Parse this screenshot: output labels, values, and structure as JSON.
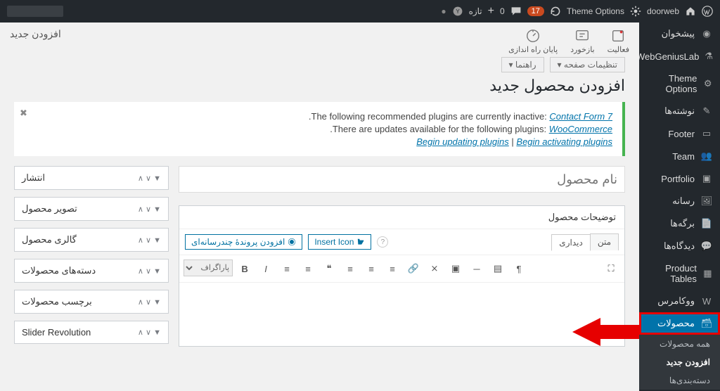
{
  "topbar": {
    "site": "doorweb",
    "theme_options": "Theme Options",
    "comments_count": "17",
    "new_count": "0",
    "new_label": "تازه",
    "blank": ""
  },
  "sidebar": {
    "items": [
      {
        "label": "پیشخوان",
        "icon": "dash"
      },
      {
        "label": "WebGeniusLab",
        "icon": "wgl"
      },
      {
        "label": "Theme Options",
        "icon": "gear"
      },
      {
        "label": "نوشته‌ها",
        "icon": "pin"
      },
      {
        "label": "Footer",
        "icon": "footer"
      },
      {
        "label": "Team",
        "icon": "team"
      },
      {
        "label": "Portfolio",
        "icon": "portfolio"
      },
      {
        "label": "رسانه",
        "icon": "media"
      },
      {
        "label": "برگه‌ها",
        "icon": "page"
      },
      {
        "label": "دیدگاه‌ها",
        "icon": "comment"
      },
      {
        "label": "Product Tables",
        "icon": "table"
      },
      {
        "label": "ووکامرس",
        "icon": "woo"
      },
      {
        "label": "محصولات",
        "icon": "archive",
        "active": true
      }
    ],
    "sub": [
      {
        "label": "همه محصولات"
      },
      {
        "label": "افزودن جدید",
        "bold": true
      },
      {
        "label": "دسته‌بندی‌ها"
      }
    ]
  },
  "wizard": {
    "tabs": [
      {
        "label": "فعالیت"
      },
      {
        "label": "بازخورد"
      },
      {
        "label": "پایان راه اندازی"
      }
    ]
  },
  "breadcrumb": "افزودن جدید",
  "screen": {
    "options": "تنظیمات صفحه ▾",
    "help": "راهنما ▾"
  },
  "page_title": "افزودن محصول جدید",
  "notice": {
    "line1_pre": ".The following recommended plugins are currently inactive: ",
    "line1_link": "Contact Form 7",
    "line2_pre": ".There are updates available for the following plugins: ",
    "line2_link": "WooCommerce",
    "action1": "Begin updating plugins",
    "sep": " | ",
    "action2": "Begin activating plugins"
  },
  "title_placeholder": "نام محصول",
  "desc_box_title": "توضیحات محصول",
  "editor": {
    "media_btn": "افزودن پروندهٔ چندرسانه‌ای",
    "insert_icon": "Insert Icon",
    "tab_visual": "دیداری",
    "tab_text": "متن",
    "para_select": "پاراگراف"
  },
  "side_boxes": [
    {
      "label": "انتشار"
    },
    {
      "label": "تصویر محصول"
    },
    {
      "label": "گالری محصول"
    },
    {
      "label": "دسته‌های محصولات"
    },
    {
      "label": "برچسب محصولات"
    },
    {
      "label": "Slider Revolution"
    }
  ]
}
